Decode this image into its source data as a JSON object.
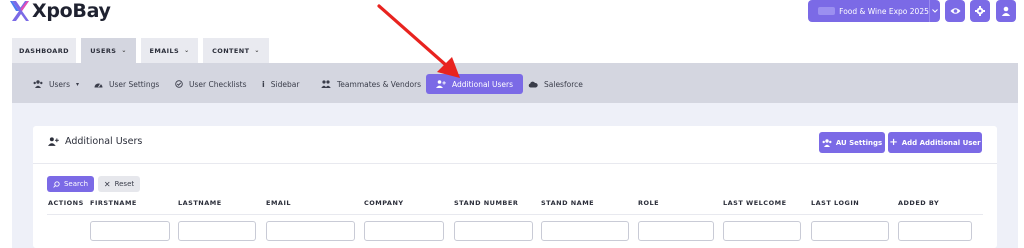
{
  "app": {
    "brand": "XpoBay"
  },
  "header": {
    "event_selector": {
      "value": "Food & Wine Expo 2025",
      "icon": "chevron-down-icon"
    },
    "actions": [
      {
        "name": "eye-icon"
      },
      {
        "name": "gear-icon"
      },
      {
        "name": "user-icon"
      }
    ]
  },
  "main_tabs": [
    {
      "label": "DASHBOARD",
      "active": false,
      "dropdown": false
    },
    {
      "label": "USERS",
      "active": true,
      "dropdown": true
    },
    {
      "label": "EMAILS",
      "active": false,
      "dropdown": true
    },
    {
      "label": "CONTENT",
      "active": false,
      "dropdown": true
    }
  ],
  "sub_nav": [
    {
      "label": "Users",
      "icon": "users-icon",
      "dropdown": true,
      "active": false
    },
    {
      "label": "User Settings",
      "icon": "dashboard-gauge-icon",
      "active": false
    },
    {
      "label": "User Checklists",
      "icon": "check-circle-icon",
      "active": false
    },
    {
      "label": "Sidebar",
      "icon": "info-icon",
      "active": false
    },
    {
      "label": "Teammates & Vendors",
      "icon": "team-icon",
      "active": false
    },
    {
      "label": "Additional Users",
      "icon": "user-plus-icon",
      "active": true
    },
    {
      "label": "Salesforce",
      "icon": "cloud-icon",
      "active": false
    }
  ],
  "card": {
    "title": "Additional Users",
    "au_settings_label": "AU Settings",
    "add_label": "Add Additional User",
    "search_label": "Search",
    "reset_label": "Reset"
  },
  "table": {
    "columns": [
      "ACTIONS",
      "FIRSTNAME",
      "LASTNAME",
      "EMAIL",
      "COMPANY",
      "STAND NUMBER",
      "STAND NAME",
      "ROLE",
      "LAST WELCOME",
      "LAST LOGIN",
      "ADDED BY"
    ]
  },
  "colors": {
    "accent": "#7b6ae6",
    "subnav_bg": "#d4d6e0",
    "content_bg": "#eef0f8",
    "annotation_arrow": "#e8231f"
  }
}
